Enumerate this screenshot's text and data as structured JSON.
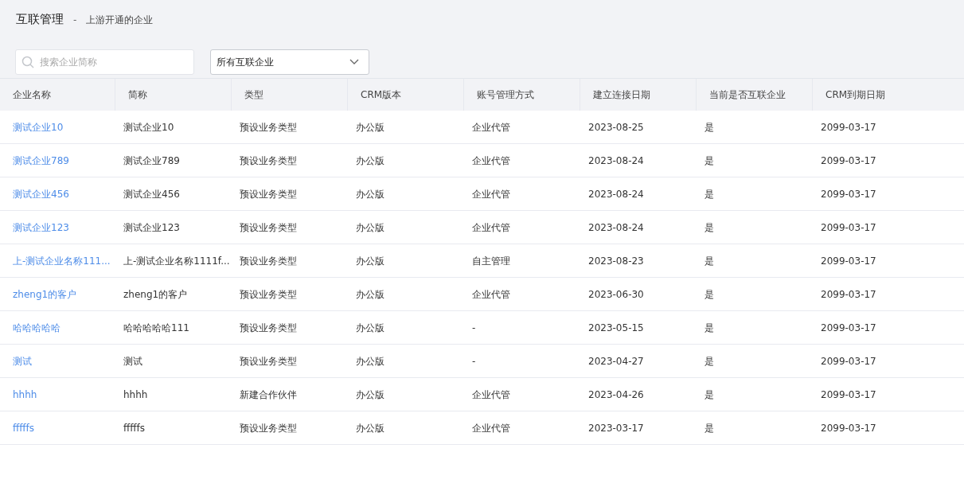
{
  "header": {
    "title": "互联管理",
    "separator": "-",
    "subtitle": "上游开通的企业"
  },
  "search": {
    "placeholder": "搜索企业简称"
  },
  "filter": {
    "value": "所有互联企业"
  },
  "table": {
    "columns": [
      "企业名称",
      "简称",
      "类型",
      "CRM版本",
      "账号管理方式",
      "建立连接日期",
      "当前是否互联企业",
      "CRM到期日期"
    ],
    "rows": [
      [
        "测试企业10",
        "测试企业10",
        "预设业务类型",
        "办公版",
        "企业代管",
        "2023-08-25",
        "是",
        "2099-03-17"
      ],
      [
        "测试企业789",
        "测试企业789",
        "预设业务类型",
        "办公版",
        "企业代管",
        "2023-08-24",
        "是",
        "2099-03-17"
      ],
      [
        "测试企业456",
        "测试企业456",
        "预设业务类型",
        "办公版",
        "企业代管",
        "2023-08-24",
        "是",
        "2099-03-17"
      ],
      [
        "测试企业123",
        "测试企业123",
        "预设业务类型",
        "办公版",
        "企业代管",
        "2023-08-24",
        "是",
        "2099-03-17"
      ],
      [
        "上-测试企业名称111...",
        "上-测试企业名称1111f...",
        "预设业务类型",
        "办公版",
        "自主管理",
        "2023-08-23",
        "是",
        "2099-03-17"
      ],
      [
        "zheng1的客户",
        "zheng1的客户",
        "预设业务类型",
        "办公版",
        "企业代管",
        "2023-06-30",
        "是",
        "2099-03-17"
      ],
      [
        "哈哈哈哈哈",
        "哈哈哈哈哈111",
        "预设业务类型",
        "办公版",
        "-",
        "2023-05-15",
        "是",
        "2099-03-17"
      ],
      [
        "测试",
        "测试",
        "预设业务类型",
        "办公版",
        "-",
        "2023-04-27",
        "是",
        "2099-03-17"
      ],
      [
        "hhhh",
        "hhhh",
        "新建合作伙伴",
        "办公版",
        "企业代管",
        "2023-04-26",
        "是",
        "2099-03-17"
      ],
      [
        "fffffs",
        "fffffs",
        "预设业务类型",
        "办公版",
        "企业代管",
        "2023-03-17",
        "是",
        "2099-03-17"
      ]
    ]
  }
}
